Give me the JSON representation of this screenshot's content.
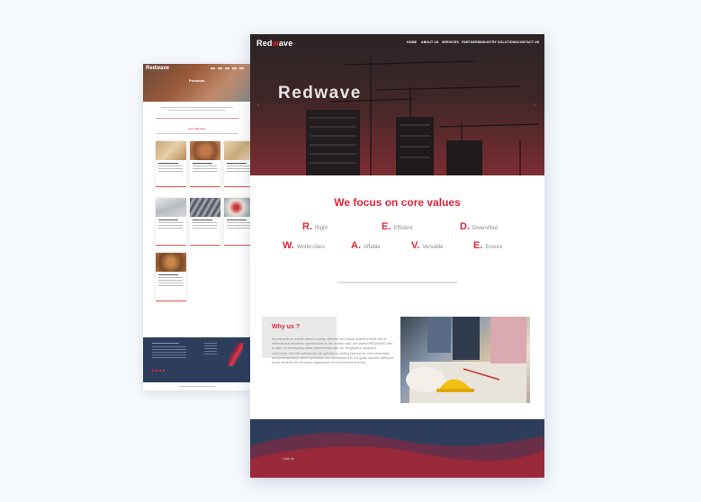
{
  "back_page": {
    "logo": "Redwave",
    "hero_title": "Products",
    "section_title": "Core Offerings"
  },
  "front_page": {
    "logo_prefix": "Red",
    "logo_accent": "w",
    "logo_suffix": "ave",
    "nav": [
      "HOME",
      "ABOUT US",
      "SERVICES",
      "PARTNERS",
      "INDUSTRY SOLUTIONS",
      "CONTACT US"
    ],
    "hero_title": "Redwave",
    "prev_arrow": "‹",
    "next_arrow": "›",
    "core_title": "We focus on core values",
    "values": [
      {
        "letter": "R.",
        "word": "Right"
      },
      {
        "letter": "E.",
        "word": "Efficient"
      },
      {
        "letter": "D.",
        "word": "Diversified"
      },
      {
        "letter": "W.",
        "word": "World-class"
      },
      {
        "letter": "A.",
        "word": "Affable"
      },
      {
        "letter": "V.",
        "word": "Versatile"
      },
      {
        "letter": "E.",
        "word": "Ensure"
      }
    ],
    "why_title": "Why us ?",
    "why_body": "As primarily an export based country, Bahrain and Saudi Arabia provide lots of international business opportunities in the middle east. We started REDWAVE with a vision of developing value partnerships with our employees, suppliers, customers, and the community we operate by setting standards, both personally and professionally, which symbolize our commitment to our goals and the fulfilment of our services for the years eight years of our business journey.",
    "footer_text": "• Ask us"
  },
  "colors": {
    "accent": "#e0263a",
    "footer": "#2e3d5b",
    "background": "#f5f8fc"
  }
}
